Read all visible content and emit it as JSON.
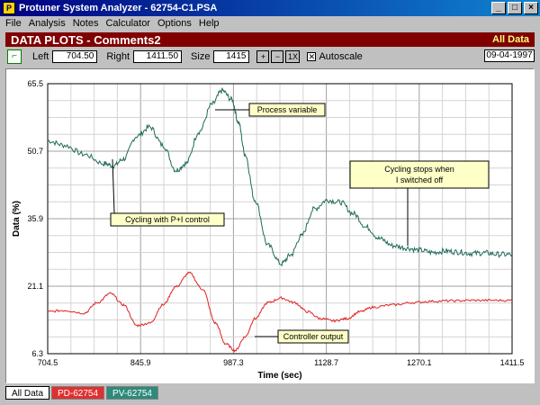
{
  "window": {
    "title": "Protuner System Analyzer - 62754-C1.PSA",
    "buttons": [
      "_",
      "□",
      "×"
    ]
  },
  "menu": [
    "File",
    "Analysis",
    "Notes",
    "Calculator",
    "Options",
    "Help"
  ],
  "banner": {
    "title": "DATA PLOTS - Comments2",
    "right": "All Data"
  },
  "toolbar": {
    "left_label": "Left",
    "left_value": "704.50",
    "right_label": "Right",
    "right_value": "1411.50",
    "size_label": "Size",
    "size_value": "1415",
    "zoom_in": "+",
    "zoom_out": "−",
    "zoom_1x": "1X",
    "autoscale_label": "Autoscale",
    "autoscale_checked": true,
    "date": "09-04-1997"
  },
  "chart_data": {
    "type": "line",
    "xlabel": "Time (sec)",
    "ylabel": "Data (%)",
    "xlim": [
      704.5,
      1411.5
    ],
    "ylim": [
      6.3,
      65.5
    ],
    "xticks": [
      "704.5",
      "845.9",
      "987.3",
      "1128.7",
      "1270.1",
      "1411.5"
    ],
    "yticks": [
      "65.5",
      "50.7",
      "35.9",
      "21.1",
      "6.3"
    ],
    "grid": true,
    "series": [
      {
        "name": "PV-62754",
        "color": "#1e6b5a",
        "x": [
          704.5,
          730,
          760,
          790,
          805,
          820,
          840,
          860,
          880,
          900,
          915,
          935,
          955,
          970,
          985,
          995,
          1005,
          1020,
          1040,
          1060,
          1075,
          1090,
          1110,
          1130,
          1150,
          1170,
          1190,
          1210,
          1230,
          1250,
          1270,
          1290,
          1310,
          1330,
          1350,
          1370,
          1390,
          1411.5
        ],
        "y": [
          53,
          52,
          50,
          48,
          47.5,
          49,
          54,
          56,
          52,
          46.5,
          48,
          55,
          61,
          64,
          62,
          57,
          50,
          40,
          30,
          26,
          28,
          32,
          38,
          40,
          39.5,
          37,
          34,
          31.5,
          30,
          29.5,
          29,
          28.5,
          28.8,
          28.6,
          28.3,
          28.4,
          28.1,
          28
        ]
      },
      {
        "name": "PD-62754",
        "color": "#e02020",
        "x": [
          704.5,
          730,
          760,
          780,
          800,
          820,
          840,
          860,
          880,
          900,
          920,
          940,
          960,
          975,
          990,
          1005,
          1020,
          1040,
          1060,
          1080,
          1100,
          1120,
          1140,
          1160,
          1180,
          1200,
          1230,
          1260,
          1290,
          1320,
          1350,
          1380,
          1411.5
        ],
        "y": [
          15.5,
          15.8,
          15.2,
          17.5,
          19.5,
          17,
          12.5,
          13,
          17,
          21,
          24,
          20.5,
          13,
          8.5,
          7,
          10,
          14,
          17.5,
          18.5,
          17.5,
          15.5,
          14,
          13.5,
          14,
          15.5,
          16.5,
          17,
          17.5,
          17.8,
          17.9,
          18,
          18,
          18
        ]
      }
    ],
    "annotations": [
      {
        "text": "Process variable"
      },
      {
        "text": "Cycling with P+I control"
      },
      {
        "text": "Cycling stops when I switched off"
      },
      {
        "text": "Controller  output"
      }
    ]
  },
  "tabs": [
    {
      "label": "All Data",
      "active": true,
      "color": "#ffffff"
    },
    {
      "label": "PD-62754",
      "active": false,
      "color": "#e03030"
    },
    {
      "label": "PV-62754",
      "active": false,
      "color": "#2e8b7a"
    }
  ]
}
